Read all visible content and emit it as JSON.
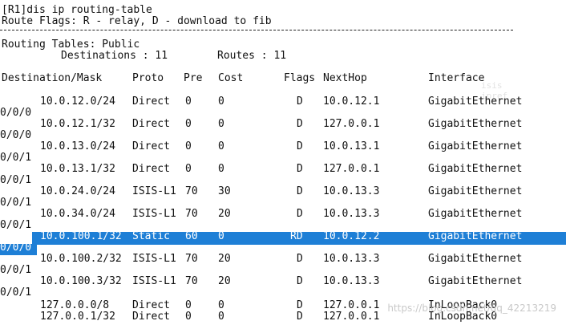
{
  "terminal": {
    "command_line": "[R1]dis ip routing-table",
    "flags_legend": "Route Flags: R - relay, D - download to fib",
    "separator": "------------------------------------------------------------------------------",
    "routing_tables": "Routing Tables: Public",
    "destinations_label": "Destinations : 11",
    "routes_label": "Routes : 11"
  },
  "table": {
    "headers": {
      "destination": "Destination/Mask",
      "proto": "Proto",
      "pre": "Pre",
      "cost": "Cost",
      "flags": "Flags",
      "nexthop": "NextHop",
      "interface": "Interface"
    },
    "rows": [
      {
        "destination": "10.0.12.0/24",
        "proto": "Direct",
        "pre": "0",
        "cost": "0",
        "flags": "D",
        "nexthop": "10.0.12.1",
        "interface": "GigabitEthernet",
        "interface_tail": "0/0/0"
      },
      {
        "destination": "10.0.12.1/32",
        "proto": "Direct",
        "pre": "0",
        "cost": "0",
        "flags": "D",
        "nexthop": "127.0.0.1",
        "interface": "GigabitEthernet",
        "interface_tail": "0/0/0"
      },
      {
        "destination": "10.0.13.0/24",
        "proto": "Direct",
        "pre": "0",
        "cost": "0",
        "flags": "D",
        "nexthop": "10.0.13.1",
        "interface": "GigabitEthernet",
        "interface_tail": "0/0/1"
      },
      {
        "destination": "10.0.13.1/32",
        "proto": "Direct",
        "pre": "0",
        "cost": "0",
        "flags": "D",
        "nexthop": "127.0.0.1",
        "interface": "GigabitEthernet",
        "interface_tail": "0/0/1"
      },
      {
        "destination": "10.0.24.0/24",
        "proto": "ISIS-L1",
        "pre": "70",
        "cost": "30",
        "flags": "D",
        "nexthop": "10.0.13.3",
        "interface": "GigabitEthernet",
        "interface_tail": "0/0/1"
      },
      {
        "destination": "10.0.34.0/24",
        "proto": "ISIS-L1",
        "pre": "70",
        "cost": "20",
        "flags": "D",
        "nexthop": "10.0.13.3",
        "interface": "GigabitEthernet",
        "interface_tail": "0/0/1"
      },
      {
        "destination": "10.0.100.1/32",
        "proto": "Static",
        "pre": "60",
        "cost": "0",
        "flags": "RD",
        "nexthop": "10.0.12.2",
        "interface": "GigabitEthernet",
        "interface_tail": "0/0/0",
        "selected": true
      },
      {
        "destination": "10.0.100.2/32",
        "proto": "ISIS-L1",
        "pre": "70",
        "cost": "20",
        "flags": "D",
        "nexthop": "10.0.13.3",
        "interface": "GigabitEthernet",
        "interface_tail": "0/0/1"
      },
      {
        "destination": "10.0.100.3/32",
        "proto": "ISIS-L1",
        "pre": "70",
        "cost": "20",
        "flags": "D",
        "nexthop": "10.0.13.3",
        "interface": "GigabitEthernet",
        "interface_tail": "0/0/1"
      },
      {
        "destination": "127.0.0.0/8",
        "proto": "Direct",
        "pre": "0",
        "cost": "0",
        "flags": "D",
        "nexthop": "127.0.0.1",
        "interface": "InLoopBack0",
        "interface_tail": ""
      },
      {
        "destination": "127.0.0.1/32",
        "proto": "Direct",
        "pre": "0",
        "cost": "0",
        "flags": "D",
        "nexthop": "127.0.0.1",
        "interface": "InLoopBack0",
        "interface_tail": ""
      }
    ]
  },
  "watermark": "https://blog.csdn.net/qq_42213219"
}
